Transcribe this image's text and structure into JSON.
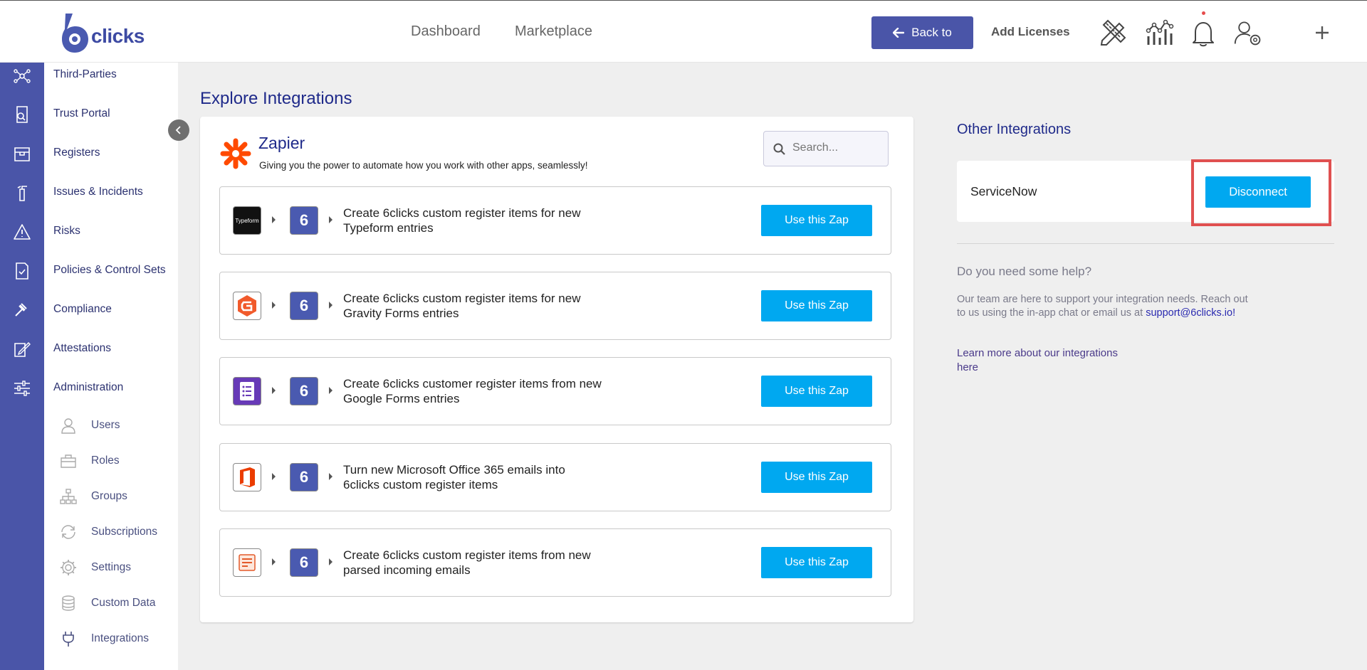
{
  "header": {
    "logo_text": "clicks",
    "nav": [
      "Dashboard",
      "Marketplace"
    ],
    "back_label": "Back to",
    "add_licenses": "Add Licenses"
  },
  "sidebar": {
    "items": [
      "Third-Parties",
      "Trust Portal",
      "Registers",
      "Issues & Incidents",
      "Risks",
      "Policies & Control Sets",
      "Compliance",
      "Attestations",
      "Administration"
    ],
    "sub_items": [
      "Users",
      "Roles",
      "Groups",
      "Subscriptions",
      "Settings",
      "Custom Data",
      "Integrations"
    ]
  },
  "main": {
    "title": "Explore Integrations",
    "zapier": {
      "name": "Zapier",
      "subtitle": "Giving you the power to automate how you work with other apps, seamlessly!",
      "search_placeholder": "Search..."
    },
    "zaps": [
      {
        "app": "Typeform",
        "line1": "Create 6clicks custom register items for new",
        "line2": "Typeform entries",
        "button": "Use this Zap"
      },
      {
        "app": "Gravity Forms",
        "line1": "Create 6clicks custom register items for new",
        "line2": "Gravity Forms entries",
        "button": "Use this Zap"
      },
      {
        "app": "Google Forms",
        "line1": "Create 6clicks customer register items from new",
        "line2": "Google Forms entries",
        "button": "Use this Zap"
      },
      {
        "app": "Microsoft Office 365",
        "line1": "Turn new Microsoft Office 365 emails into",
        "line2": "6clicks custom register items",
        "button": "Use this Zap"
      },
      {
        "app": "Email Parser",
        "line1": "Create 6clicks custom register items from new",
        "line2": "parsed incoming emails",
        "button": "Use this Zap"
      }
    ],
    "six_label": "6",
    "typeform_label": "Typeform"
  },
  "right": {
    "title": "Other Integrations",
    "service_name": "ServiceNow",
    "disconnect": "Disconnect",
    "help_title": "Do you need some help?",
    "help_text": "Our team are here to support your integration needs. Reach out to us using the in-app chat or email us at",
    "help_email": "support@6clicks.io!",
    "learn_more": "Learn more about our integrations here"
  },
  "colors": {
    "brand": "#4a55a8",
    "accent": "#00a8f0",
    "highlight": "#e05050"
  }
}
